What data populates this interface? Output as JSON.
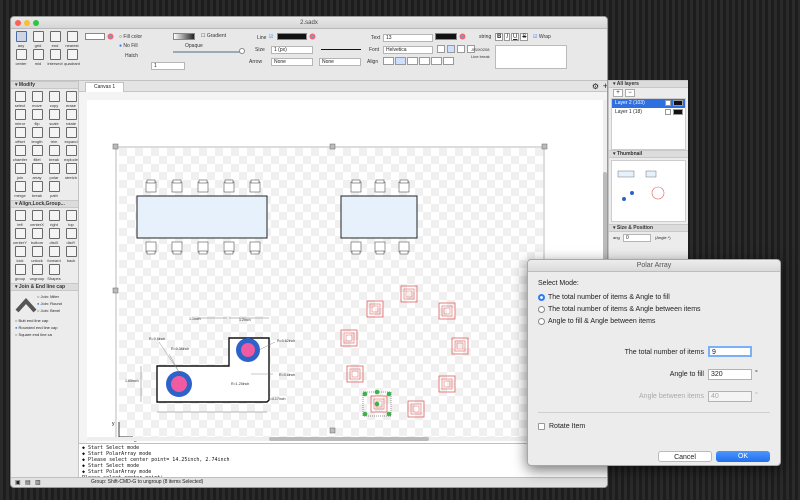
{
  "window": {
    "title": "2.sadx"
  },
  "toolbar": {
    "fill_color_label": "Fill color",
    "no_fill_label": "No Fill",
    "hatch_label": "Hatch",
    "gradient_label": "Gradient",
    "opaque_label": "Opaque",
    "hatch_value": "1",
    "line_label": "Line",
    "size_label": "Size",
    "size_value": "1 (px)",
    "arrow_label": "Arrow",
    "arrow_start": "None",
    "arrow_end": "None",
    "text_label": "Text",
    "text_size": "13",
    "font_label": "Font",
    "font_value": "Helvetica",
    "align_label": "Align",
    "string_label": "string",
    "bold": "B",
    "italic": "I",
    "underline": "U",
    "strike": "S",
    "wrap_label": "Wrap",
    "jis_label": "JIS/X0208",
    "line_break_label": "Line break"
  },
  "tools_top": [
    {
      "name": "any",
      "label": "any"
    },
    {
      "name": "grid",
      "label": "grid"
    },
    {
      "name": "end",
      "label": "end"
    },
    {
      "name": "nearest",
      "label": "nearest"
    },
    {
      "name": "center",
      "label": "center"
    },
    {
      "name": "mid",
      "label": "mid"
    },
    {
      "name": "intersect",
      "label": "intersect"
    },
    {
      "name": "quadrant",
      "label": "quadrant"
    }
  ],
  "modify_title": "Modify",
  "modify_tools": [
    {
      "name": "select",
      "label": "select"
    },
    {
      "name": "move",
      "label": "move"
    },
    {
      "name": "copy",
      "label": "copy"
    },
    {
      "name": "erase",
      "label": "erase"
    },
    {
      "name": "mirror",
      "label": "mirror"
    },
    {
      "name": "flip",
      "label": "flip"
    },
    {
      "name": "scale",
      "label": "scale"
    },
    {
      "name": "rotate",
      "label": "rotate"
    },
    {
      "name": "offset",
      "label": "offset"
    },
    {
      "name": "length",
      "label": "length"
    },
    {
      "name": "trim",
      "label": "trim"
    },
    {
      "name": "expand",
      "label": "expand"
    },
    {
      "name": "chamfer",
      "label": "chamfer"
    },
    {
      "name": "fillet",
      "label": "fillet"
    },
    {
      "name": "break",
      "label": "break"
    },
    {
      "name": "explode",
      "label": "explode"
    },
    {
      "name": "join",
      "label": "join"
    },
    {
      "name": "array",
      "label": "array"
    },
    {
      "name": "polar",
      "label": "polar"
    },
    {
      "name": "stretch",
      "label": "stretch"
    },
    {
      "name": "merge",
      "label": "merge"
    },
    {
      "name": "break2",
      "label": "break"
    },
    {
      "name": "path",
      "label": "path"
    }
  ],
  "align_title": "Align,Lock,Group...",
  "align_tools": [
    {
      "name": "left",
      "label": "left"
    },
    {
      "name": "centerx",
      "label": "centerX"
    },
    {
      "name": "right",
      "label": "right"
    },
    {
      "name": "top",
      "label": "top"
    },
    {
      "name": "centery",
      "label": "centerY"
    },
    {
      "name": "bottom",
      "label": "bottom"
    },
    {
      "name": "distx",
      "label": "distX"
    },
    {
      "name": "disty",
      "label": "distY"
    },
    {
      "name": "lock",
      "label": "lock"
    },
    {
      "name": "unlock",
      "label": "unlock"
    },
    {
      "name": "forward",
      "label": "forward"
    },
    {
      "name": "back",
      "label": "back"
    },
    {
      "name": "group",
      "label": "group"
    },
    {
      "name": "ungroup",
      "label": "ungroup"
    },
    {
      "name": "shapes",
      "label": "Shapes"
    }
  ],
  "joinend": {
    "title": "Join & End line cap",
    "join_options": [
      "Join: Miter",
      "Join: Round",
      "Join: Bevel"
    ],
    "cap_options": [
      "Butt end line cap",
      "Rounded end line cap",
      "Square end line ca"
    ]
  },
  "canvas": {
    "tab_label": "Canvas 1"
  },
  "dims": {
    "r1": "R=0.8inch",
    "r2": "R=0.38inch",
    "r3": "R=0.62inch",
    "r4": "R=0.8inch",
    "r5": "R=1.25inch",
    "l1": "1.1inch",
    "l2": "1.2inch",
    "l3": "1.65inch",
    "l4": "l=4.17inch",
    "axis_x": "x",
    "axis_y": "y"
  },
  "layers": {
    "title": "All layers",
    "items": [
      "Layer 2 (103)",
      "Layer 1 (18)"
    ]
  },
  "thumbnail": {
    "title": "Thumbnail"
  },
  "size_position": {
    "title": "Size & Position",
    "angle_label": "ang",
    "angle_value": "0",
    "angle_unit": "(Angle *)"
  },
  "console": {
    "lines": [
      "◆ Start Select mode",
      "◆ Start PolarArray mode",
      "◆ Please select center point= 14.25inch, 2.74inch",
      "◆ Start Select mode",
      "◆ Start PolarArray mode",
      "Please select center point❘"
    ]
  },
  "status": {
    "text": "Group: Shift-CMD-G to ungroup (8 items Selected)",
    "zoom": "100%"
  },
  "dialog": {
    "title": "Polar Array",
    "select_mode_label": "Select Mode:",
    "modes": [
      "The total number of items & Angle to fill",
      "The total number of items & Angle between items",
      "Angle to fill & Angle between items"
    ],
    "total_label": "The total number of items",
    "total_value": "9",
    "angle_fill_label": "Angle to fill",
    "angle_fill_value": "320",
    "angle_between_label": "Angle between items",
    "angle_between_value": "40",
    "deg": "°",
    "rotate_label": "Rotate Item",
    "cancel_label": "Cancel",
    "ok_label": "OK"
  }
}
